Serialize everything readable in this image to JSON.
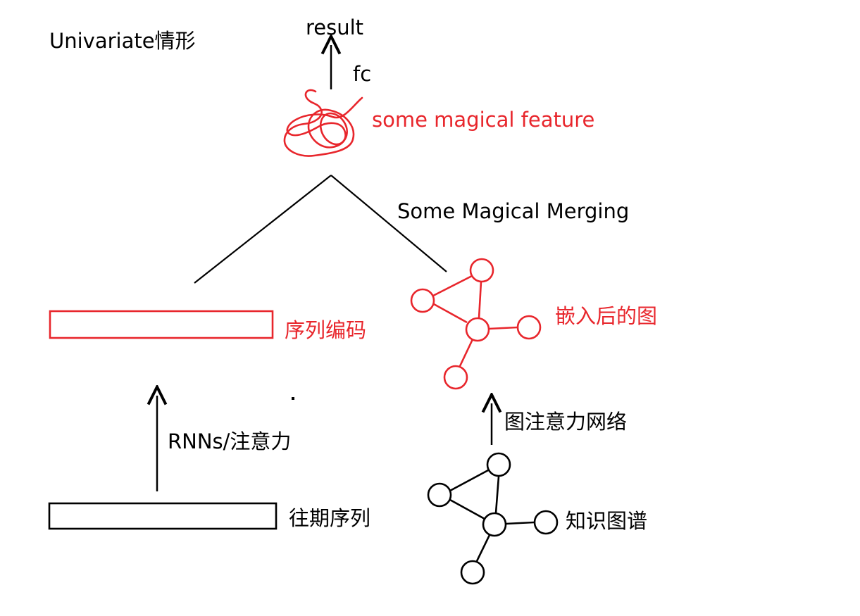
{
  "title": "Univariate情形",
  "colors": {
    "red": "#e8262c",
    "black": "#000000",
    "background": "#ffffff"
  },
  "top": {
    "result_label": "result",
    "fc_label": "fc",
    "feature_label": "some magical feature",
    "merging_label": "Some Magical Merging"
  },
  "left_branch": {
    "encoded_label": "序列编码",
    "arrow_label": "RNNs/注意力",
    "input_label": "往期序列"
  },
  "right_branch": {
    "embedded_label": "嵌入后的图",
    "arrow_label": "图注意力网络",
    "input_label": "知识图谱"
  }
}
